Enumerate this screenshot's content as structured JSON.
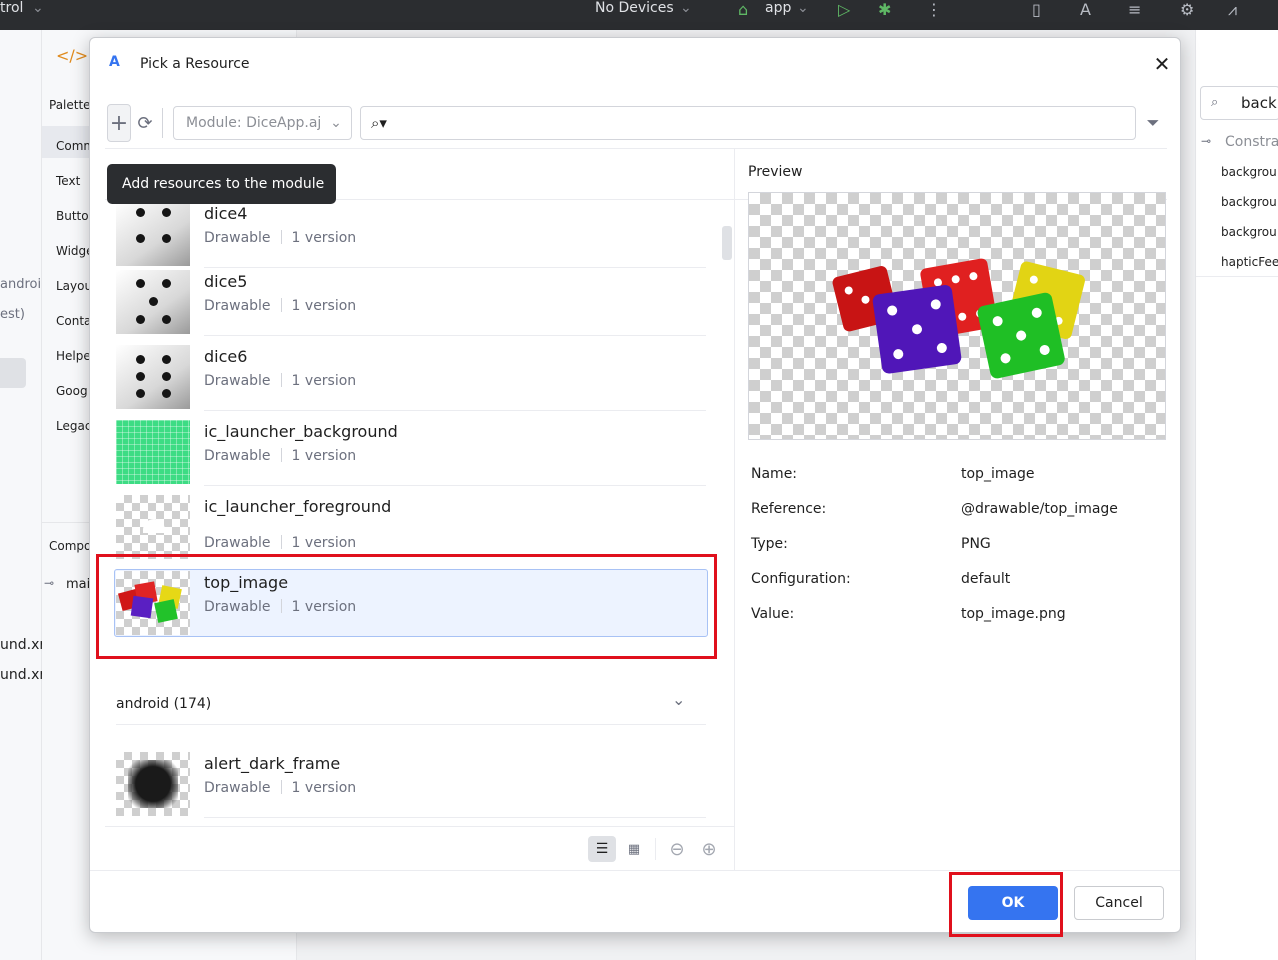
{
  "ide": {
    "top_left_text": "trol",
    "devices": "No Devices",
    "run_config": "app",
    "palette_title": "Palette",
    "palette_items": [
      "Comm",
      "Text",
      "Butto",
      "Widge",
      "Layou",
      "Conta",
      "Helpe",
      "Goog",
      "Legac"
    ],
    "component_tree_title": "Compo",
    "component_tree_item": "mai",
    "left_cut_texts": [
      "androi",
      "est)",
      "und.xr",
      "und.xm"
    ],
    "right_search_value": "back",
    "right_group": "Constrai",
    "right_attributes": [
      "backgrou",
      "backgrou",
      "backgrou",
      "hapticFee"
    ]
  },
  "dialog": {
    "title": "Pick a Resource",
    "module_select": "Module: DiceApp.aj",
    "search_placeholder": "",
    "tooltip": "Add resources to the module",
    "resources": [
      {
        "name": "dice4",
        "type": "Drawable",
        "versions": "1 version"
      },
      {
        "name": "dice5",
        "type": "Drawable",
        "versions": "1 version"
      },
      {
        "name": "dice6",
        "type": "Drawable",
        "versions": "1 version"
      },
      {
        "name": "ic_launcher_background",
        "type": "Drawable",
        "versions": "1 version"
      },
      {
        "name": "ic_launcher_foreground",
        "type": "Drawable",
        "versions": "1 version"
      },
      {
        "name": "top_image",
        "type": "Drawable",
        "versions": "1 version"
      }
    ],
    "android_section": "android (174)",
    "android_resources": [
      {
        "name": "alert_dark_frame",
        "type": "Drawable",
        "versions": "1 version"
      }
    ],
    "preview": {
      "title": "Preview",
      "properties": [
        {
          "label": "Name:",
          "value": "top_image"
        },
        {
          "label": "Reference:",
          "value": "@drawable/top_image"
        },
        {
          "label": "Type:",
          "value": "PNG"
        },
        {
          "label": "Configuration:",
          "value": "default"
        },
        {
          "label": "Value:",
          "value": "top_image.png"
        }
      ]
    },
    "ok_label": "OK",
    "cancel_label": "Cancel",
    "colors": {
      "accent": "#3574f0",
      "highlight": "#e0101c",
      "selected_row": "#edf3ff"
    }
  }
}
